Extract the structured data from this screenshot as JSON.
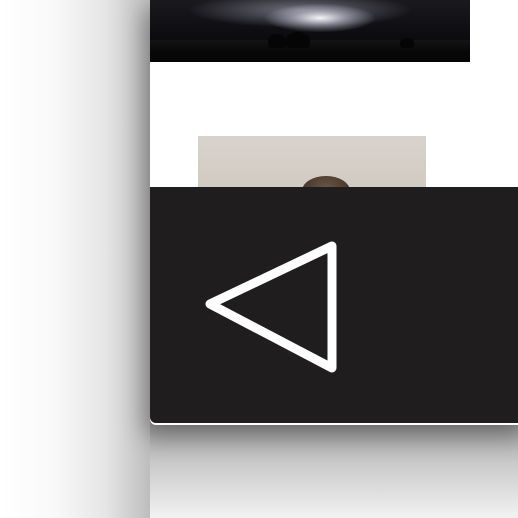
{
  "screen": {
    "images": [
      {
        "name": "lightning-storm-photo"
      },
      {
        "name": "portrait-photo"
      }
    ]
  },
  "navigation": {
    "back_icon": "back-triangle-icon",
    "overlay_color": "#1f1d1e",
    "icon_color": "#ffffff"
  }
}
